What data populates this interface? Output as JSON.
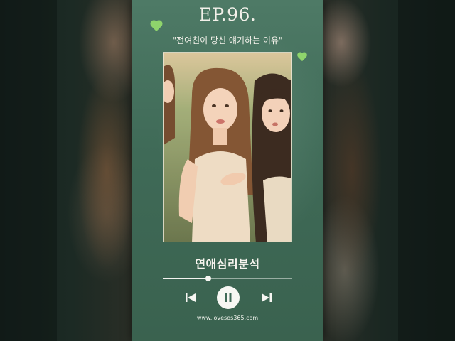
{
  "episode": {
    "title": "EP.96."
  },
  "subtitle": "\"전여친이 당신 얘기하는 이유\"",
  "category": "연애심리분석",
  "player": {
    "progress": 0.35,
    "prev_icon": "skip-previous-icon",
    "play_state_icon": "pause-icon",
    "next_icon": "skip-next-icon"
  },
  "footer": {
    "url": "www.lovesos365.com"
  },
  "colors": {
    "card_background": "#436e5a",
    "heart": "#8fd46c",
    "text": "#f3f1ea"
  }
}
